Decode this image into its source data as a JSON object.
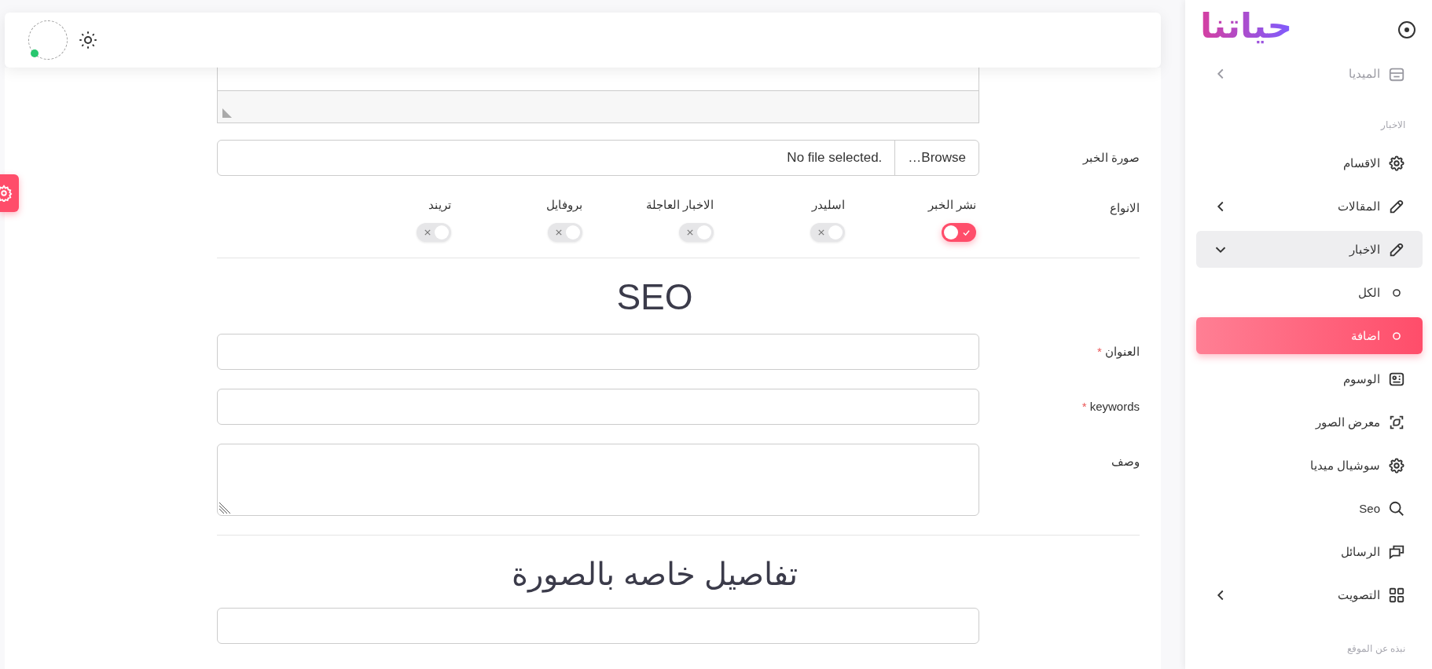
{
  "navbar": {
    "user": {
      "online": true
    }
  },
  "form": {
    "image_field": {
      "label": "صورة الخبر",
      "button": "…Browse",
      "status": "No file selected."
    },
    "types": {
      "label": "الانواع",
      "options": [
        {
          "label": "نشر الخبر",
          "on": true
        },
        {
          "label": "اسليدر",
          "on": false
        },
        {
          "label": "الاخبار العاجلة",
          "on": false
        },
        {
          "label": "بروفايل",
          "on": false
        },
        {
          "label": "تريند",
          "on": false
        }
      ]
    },
    "seo_heading": "SEO",
    "seo_fields": [
      {
        "label": "العنوان",
        "required": true,
        "kind": "input"
      },
      {
        "label": "keywords",
        "required": true,
        "kind": "input"
      },
      {
        "label": "وصف",
        "required": false,
        "kind": "textarea"
      }
    ],
    "required_mark": "*",
    "image_heading": "تفاصيل خاصه بالصورة"
  },
  "sidebar": {
    "logo": "حياتنا",
    "items": [
      {
        "kind": "item",
        "label": "الميديا",
        "dimmed": true,
        "expanded": false,
        "selected": false
      },
      {
        "kind": "section",
        "label": "الاخبار"
      },
      {
        "kind": "item",
        "label": "الاقسام",
        "dimmed": false,
        "selected": false
      },
      {
        "kind": "item",
        "label": "المقالات",
        "dimmed": false,
        "expanded": false,
        "selected": false
      },
      {
        "kind": "item",
        "label": "الاخبار",
        "dimmed": false,
        "expanded": true,
        "selected": false,
        "children": [
          {
            "label": "الكل",
            "selected": false
          },
          {
            "label": "اضافة",
            "selected": true
          }
        ]
      },
      {
        "kind": "item",
        "label": "الوسوم",
        "dimmed": false,
        "selected": false
      },
      {
        "kind": "item",
        "label": "معرض الصور",
        "dimmed": false,
        "selected": false
      },
      {
        "kind": "item",
        "label": "سوشيال ميديا",
        "dimmed": false,
        "selected": false
      },
      {
        "kind": "item",
        "label": "Seo",
        "dimmed": false,
        "selected": false
      },
      {
        "kind": "item",
        "label": "الرسائل",
        "dimmed": false,
        "selected": false
      },
      {
        "kind": "item",
        "label": "التصويت",
        "dimmed": false,
        "expanded": false,
        "selected": false
      },
      {
        "kind": "section",
        "label": "نبذه عن الموقع"
      }
    ]
  }
}
